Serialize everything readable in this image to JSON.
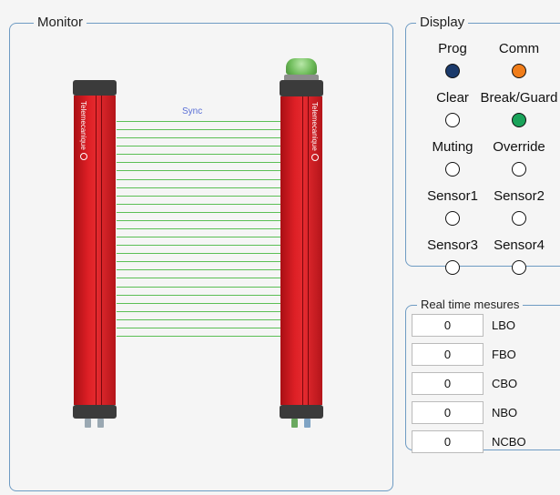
{
  "monitor": {
    "title": "Monitor",
    "sync_label": "Sync",
    "brand": "Telemecanique",
    "beam_count": 27
  },
  "display": {
    "title": "Display",
    "indicators": [
      {
        "label": "Prog",
        "state": "on",
        "color": "#1b3a6b"
      },
      {
        "label": "Comm",
        "state": "on",
        "color": "#f07d1a"
      },
      {
        "label": "Clear",
        "state": "off",
        "color": "#ffffff"
      },
      {
        "label": "Break/Guard",
        "state": "on",
        "color": "#1aa35a"
      },
      {
        "label": "Muting",
        "state": "off",
        "color": "#ffffff"
      },
      {
        "label": "Override",
        "state": "off",
        "color": "#ffffff"
      },
      {
        "label": "Sensor1",
        "state": "off",
        "color": "#ffffff"
      },
      {
        "label": "Sensor2",
        "state": "off",
        "color": "#ffffff"
      },
      {
        "label": "Sensor3",
        "state": "off",
        "color": "#ffffff"
      },
      {
        "label": "Sensor4",
        "state": "off",
        "color": "#ffffff"
      }
    ]
  },
  "realtime": {
    "title": "Real time mesures",
    "rows": [
      {
        "value": "0",
        "label": "LBO"
      },
      {
        "value": "0",
        "label": "FBO"
      },
      {
        "value": "0",
        "label": "CBO"
      },
      {
        "value": "0",
        "label": "NBO"
      },
      {
        "value": "0",
        "label": "NCBO"
      }
    ]
  },
  "colors": {
    "frame": "#6e9bc3",
    "device_red": "#de2026",
    "beam_green": "#5bbf55",
    "dome_green": "#6dbb59"
  }
}
